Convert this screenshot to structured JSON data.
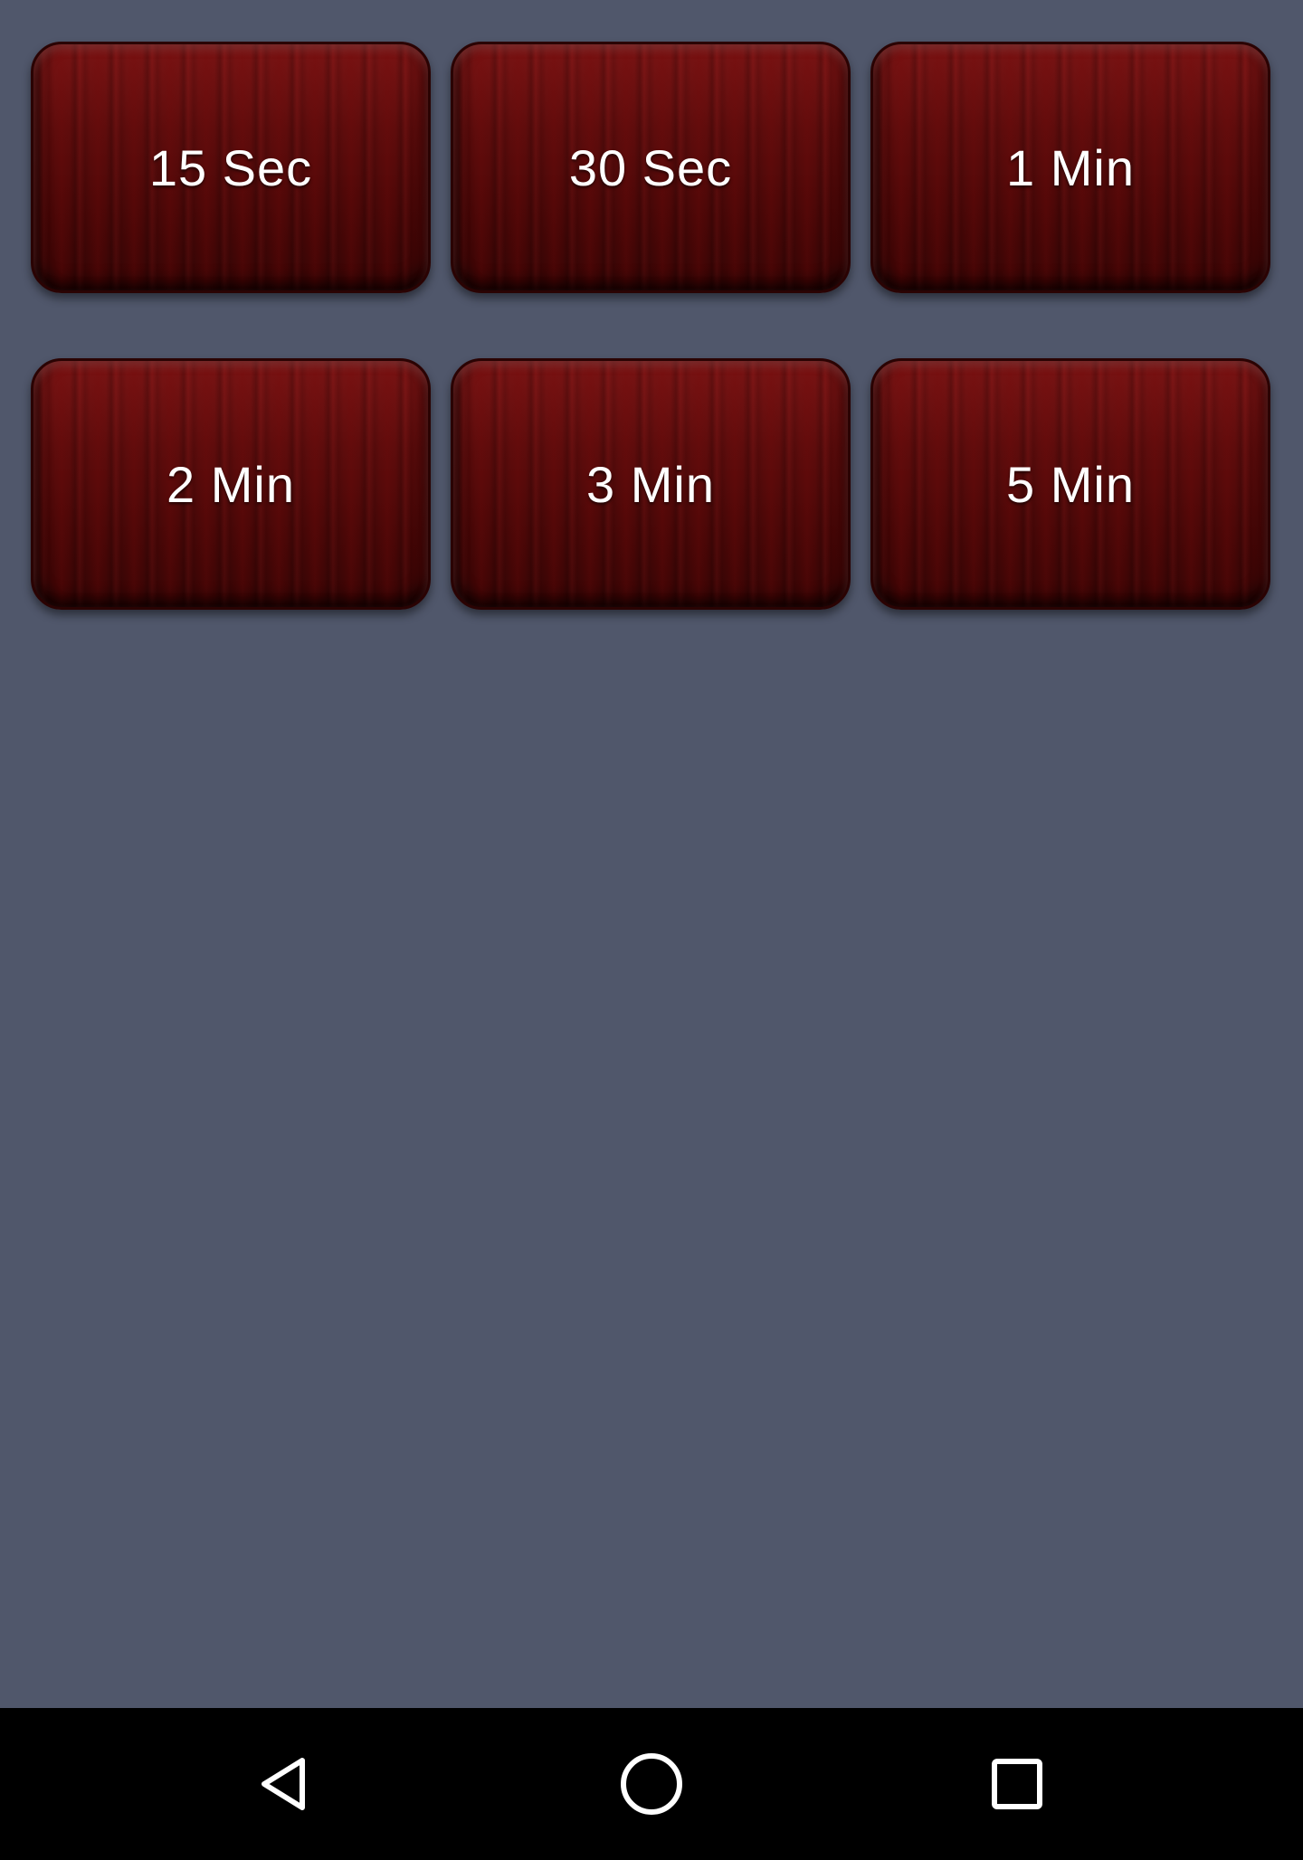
{
  "buttons": [
    {
      "label": "15 Sec"
    },
    {
      "label": "30 Sec"
    },
    {
      "label": "1 Min"
    },
    {
      "label": "2 Min"
    },
    {
      "label": "3 Min"
    },
    {
      "label": "5 Min"
    }
  ],
  "colors": {
    "background": "#50576b",
    "button_base": "#5e0c0c",
    "nav_bar": "#000000",
    "text": "#ffffff"
  },
  "nav_bar": {
    "icons": [
      "back-triangle-icon",
      "home-circle-icon",
      "recents-square-icon"
    ]
  }
}
